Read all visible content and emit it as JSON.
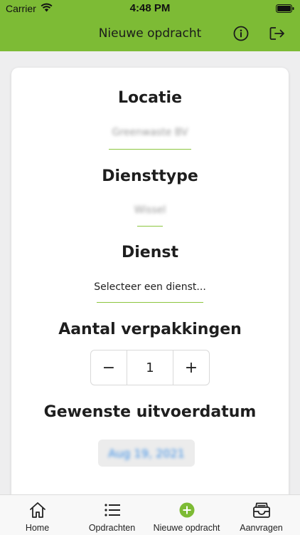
{
  "status_bar": {
    "carrier": "Carrier",
    "time": "4:48 PM"
  },
  "nav": {
    "title": "Nieuwe opdracht",
    "info_icon": "info-icon",
    "logout_icon": "logout-icon"
  },
  "colors": {
    "accent": "#7dbb35",
    "underline": "#8cc63f",
    "date_text": "#3a8ee6"
  },
  "form": {
    "location": {
      "label": "Locatie",
      "value": "Greenwaste BV"
    },
    "service_type": {
      "label": "Diensttype",
      "value": "Wissel"
    },
    "service": {
      "label": "Dienst",
      "placeholder": "Selecteer een dienst..."
    },
    "packages": {
      "label": "Aantal verpakkingen",
      "minus": "−",
      "value": "1",
      "plus": "+"
    },
    "date": {
      "label": "Gewenste uitvoerdatum",
      "value": "Aug 19, 2021"
    }
  },
  "tabs": [
    {
      "label": "Home",
      "icon": "home-icon"
    },
    {
      "label": "Opdrachten",
      "icon": "list-icon"
    },
    {
      "label": "Nieuwe opdracht",
      "icon": "plus-circle-icon"
    },
    {
      "label": "Aanvragen",
      "icon": "inbox-icon"
    }
  ]
}
